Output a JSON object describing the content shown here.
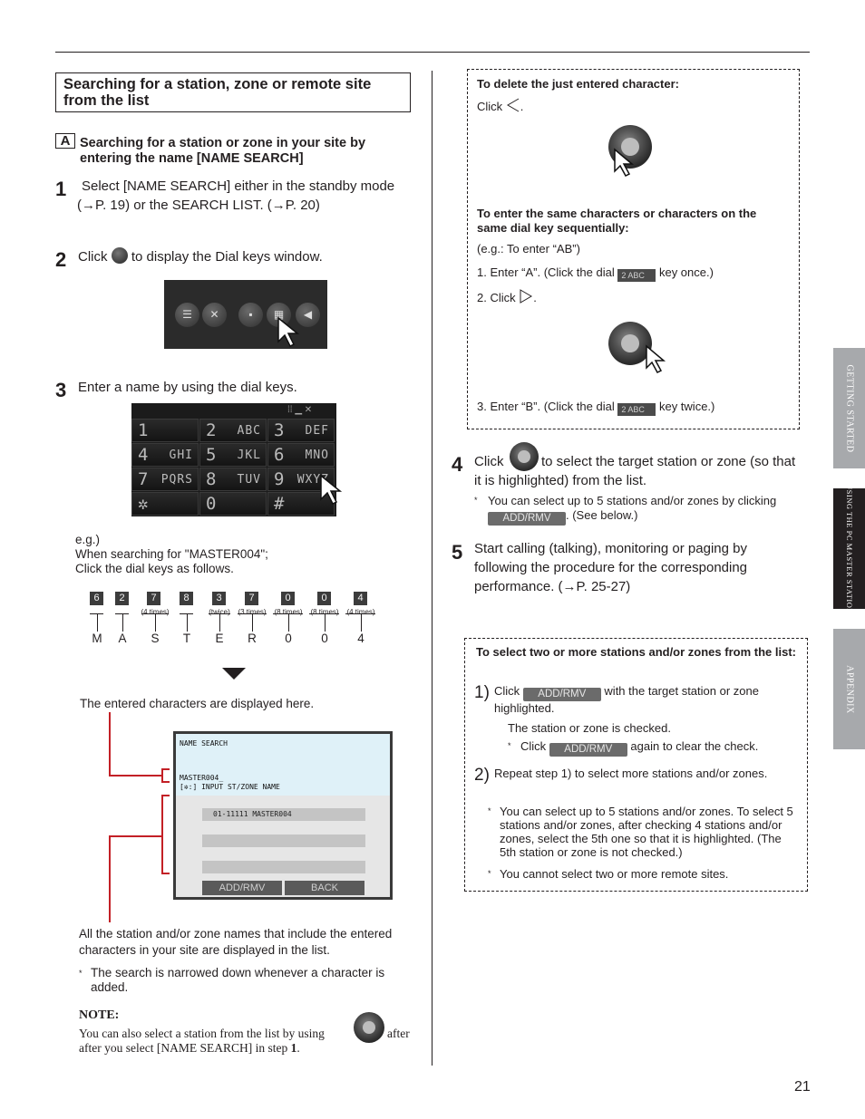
{
  "section_title": "Searching for a station, zone or remote site from the list",
  "sub": {
    "letter": "A",
    "title": "Searching for a station or zone in your site by entering the name [NAME SEARCH]"
  },
  "steps": {
    "s1": {
      "num": "1",
      "text": "Select [NAME SEARCH] either in the standby mode (→P. 19) or the SEARCH LIST. (→P. 20)"
    },
    "s2": {
      "num": "2",
      "pre": "Click",
      "post": "to display the Dial keys window."
    },
    "s3": {
      "num": "3",
      "text": "Enter a name by using the dial keys."
    },
    "s4": {
      "num": "4",
      "pre": "Click",
      "post": "to select the target station or zone (so that it is highlighted) from the list.",
      "note_pre": "You can select up to 5 stations and/or zones by clicking",
      "note_post": ". (See below.)"
    },
    "s5": {
      "num": "5",
      "text": "Start calling (talking), monitoring or paging by following the procedure for the corresponding performance.  (→P. 25-27)"
    }
  },
  "dialpad": {
    "keys": [
      {
        "n": "1",
        "l": ""
      },
      {
        "n": "2",
        "l": "ABC"
      },
      {
        "n": "3",
        "l": "DEF"
      },
      {
        "n": "4",
        "l": "GHI"
      },
      {
        "n": "5",
        "l": "JKL"
      },
      {
        "n": "6",
        "l": "MNO"
      },
      {
        "n": "7",
        "l": "PQRS"
      },
      {
        "n": "8",
        "l": "TUV"
      },
      {
        "n": "9",
        "l": "WXYZ"
      },
      {
        "n": "✲",
        "l": ""
      },
      {
        "n": "0",
        "l": ""
      },
      {
        "n": "#",
        "l": ""
      }
    ]
  },
  "example": {
    "line1": "e.g.)",
    "line2": "When searching for \"MASTER004\";",
    "line3": "Click the dial keys as follows.",
    "keys": [
      "6",
      "2",
      "7",
      "8",
      "3",
      "7",
      "0",
      "0",
      "4"
    ],
    "times": [
      "",
      "",
      "(4 times)",
      "",
      "(twice)",
      "(3 times)",
      "(8 times)",
      "(8 times)",
      "(4 times)"
    ],
    "letters": [
      "M",
      "A",
      "S",
      "T",
      "E",
      "R",
      "0",
      "0",
      "4"
    ]
  },
  "entered_caption": "The entered characters are displayed here.",
  "screen": {
    "title": "NAME SEARCH",
    "input": "MASTER004_",
    "hint": "[✲:] INPUT ST/ZONE NAME",
    "row1": "01-11111 MASTER004",
    "btn1": "ADD/RMV",
    "btn2": "BACK"
  },
  "list_caption": "All the station and/or zone names that include the entered characters in your site are displayed in the list.",
  "narrow_note": "The search is narrowed down whenever a character is added.",
  "note": {
    "heading": "NOTE:",
    "pre": "You can also select a station from the list by using",
    "post": "after you select [NAME SEARCH] in step",
    "step": "1",
    "end": "."
  },
  "box1": {
    "delete_title": "To delete the just entered character:",
    "delete_text": "Click",
    "same_title": "To enter the same characters or characters on the same dial key sequentially:",
    "eg": "(e.g.: To enter “AB”)",
    "l1_pre": "1. Enter “A”. (Click the dial",
    "l1_post": "key once.)",
    "l2": "2. Click",
    "l3_pre": "3. Enter “B”. (Click the dial",
    "l3_post": "key twice.)",
    "key_label": "2  ABC"
  },
  "btn_addrmv": "ADD/RMV",
  "box2": {
    "title": "To select two or more stations and/or zones from the list:",
    "n1": "1)",
    "t1_pre": "Click",
    "t1_post": "with the target station or zone highlighted.",
    "checked": "The station or zone is checked.",
    "clear_pre": "Click",
    "clear_post": "again to clear the check.",
    "n2": "2)",
    "t2": "Repeat step 1) to select more stations and/or zones.",
    "note1": "You can select up to 5 stations and/or zones. To select 5 stations and/or zones, after checking 4 stations and/or zones, select the 5th one so that it is highlighted. (The 5th station or zone is not checked.)",
    "note2": "You cannot select two or more remote sites."
  },
  "asterisk": "*",
  "tabs": [
    "GETTING STARTED",
    "USING THE PC MASTER STATION",
    "APPENDIX"
  ],
  "colors": {
    "tab_gray": "#a7a9ac",
    "tab_dark": "#231f20",
    "red_line": "#c32026"
  },
  "page_number": "21"
}
